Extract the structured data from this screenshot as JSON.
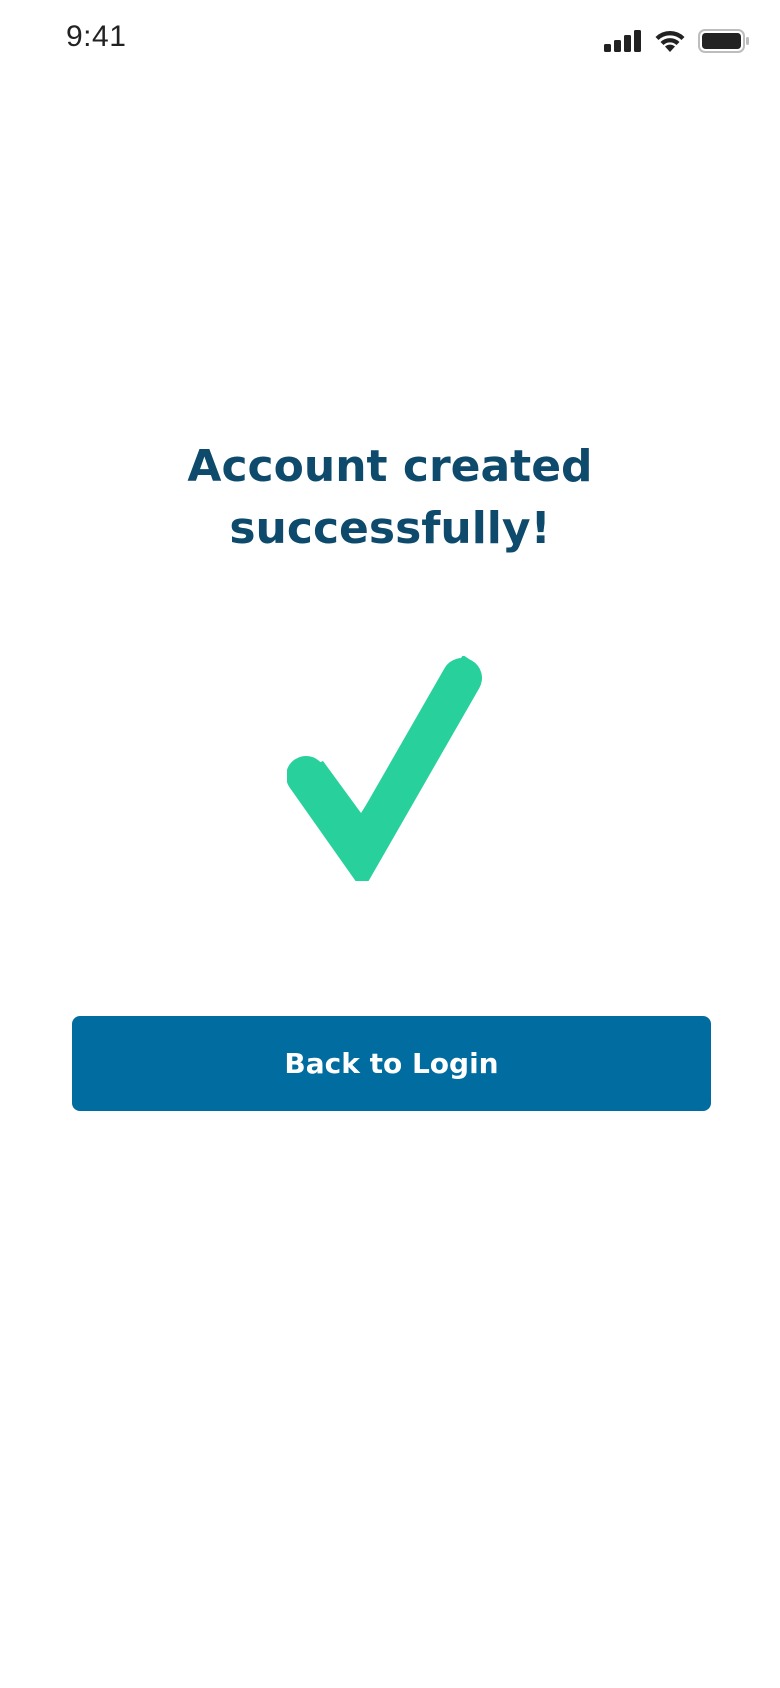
{
  "status_bar": {
    "time": "9:41",
    "icons": [
      "cellular-signal-icon",
      "wifi-icon",
      "battery-icon"
    ]
  },
  "success": {
    "title_line1": "Account created",
    "title_line2": "successfully!",
    "icon": "checkmark-icon"
  },
  "actions": {
    "back_to_login_label": "Back to Login"
  },
  "colors": {
    "title": "#0d4a6b",
    "check": "#28d19b",
    "button": "#006c9f",
    "button_text": "#ffffff"
  }
}
